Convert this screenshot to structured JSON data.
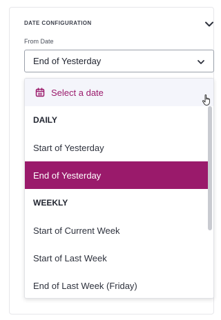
{
  "section": {
    "title": "DATE CONFIGURATION"
  },
  "field": {
    "label": "From Date",
    "value": "End of Yesterday"
  },
  "dropdown": {
    "date_picker_label": "Select a date",
    "groups": [
      {
        "header": "DAILY",
        "options": [
          "Start of Yesterday",
          "End of Yesterday"
        ]
      },
      {
        "header": "WEEKLY",
        "options": [
          "Start of Current Week",
          "Start of Last Week",
          "End of Last Week (Friday)"
        ]
      }
    ],
    "selected": "End of Yesterday"
  },
  "colors": {
    "accent": "#9a1a6b",
    "picker_bg": "#f4f5fb"
  },
  "icons": {
    "collapse": "chevron-down-icon",
    "select": "chevron-down-icon",
    "calendar": "calendar-icon",
    "cursor": "hand-pointer-icon"
  }
}
